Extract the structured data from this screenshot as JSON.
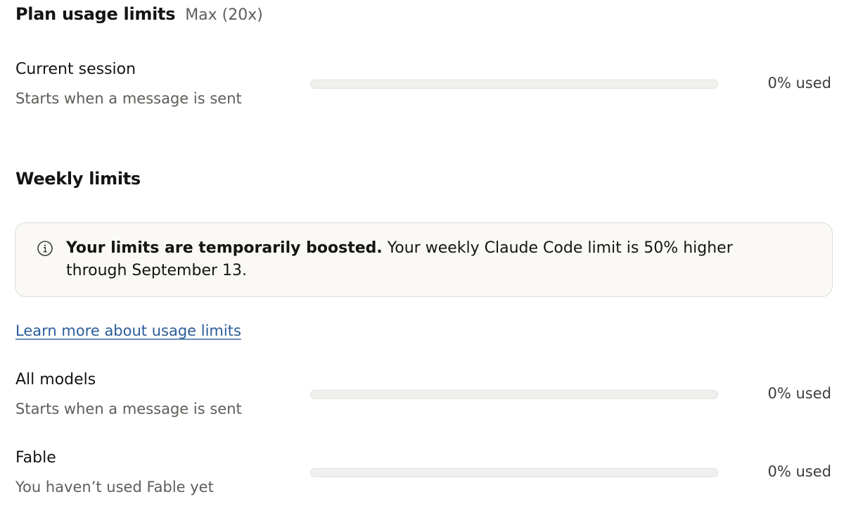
{
  "plan": {
    "title": "Plan usage limits",
    "tier": "Max (20x)"
  },
  "current_session": {
    "label": "Current session",
    "subtitle": "Starts when a message is sent",
    "used_percent": 0,
    "used_label": "0% used"
  },
  "weekly": {
    "title": "Weekly limits",
    "notice": {
      "icon": "info-icon",
      "bold": "Your limits are temporarily boosted.",
      "text": " Your weekly Claude Code limit is 50% higher through September 13."
    },
    "learn_more": "Learn more about usage limits",
    "items": [
      {
        "label": "All models",
        "subtitle": "Starts when a message is sent",
        "used_percent": 0,
        "used_label": "0% used"
      },
      {
        "label": "Fable",
        "subtitle": "You haven’t used Fable yet",
        "used_percent": 0,
        "used_label": "0% used"
      }
    ]
  },
  "colors": {
    "progress_fill": "#2c84db",
    "link": "#2b5d9a"
  }
}
